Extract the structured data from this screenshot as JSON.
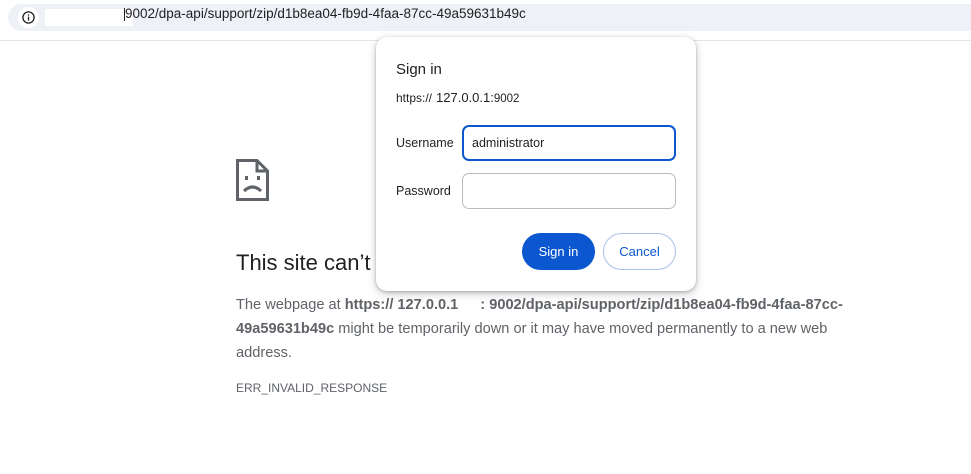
{
  "address_bar": {
    "url": "9002/dpa-api/support/zip/d1b8ea04-fb9d-4faa-87cc-49a59631b49c",
    "site_info_icon": "info-icon"
  },
  "error_page": {
    "icon": "sad-page-icon",
    "title": "This site can’t",
    "body": {
      "prefix": "The webpage at ",
      "host": "https:// 127.0.0.1",
      "path": ": 9002/dpa-api/support/zip/d1b8ea04-fb9d-4faa-87cc-49a59631b49c",
      "suffix": " might be temporarily down or it may have moved permanently to a new web address."
    },
    "error_code": "ERR_INVALID_RESPONSE"
  },
  "dialog": {
    "title": "Sign in",
    "origin_scheme": "https://",
    "origin_host": "127.0.0.1:",
    "origin_port": "9002",
    "username_label": "Username",
    "username_value": "administrator",
    "password_label": "Password",
    "password_value": "",
    "signin_label": "Sign in",
    "cancel_label": "Cancel"
  },
  "colors": {
    "accent": "#0b57d0",
    "error_text": "#5f6368",
    "omnibox_bg": "#eef1f6"
  }
}
